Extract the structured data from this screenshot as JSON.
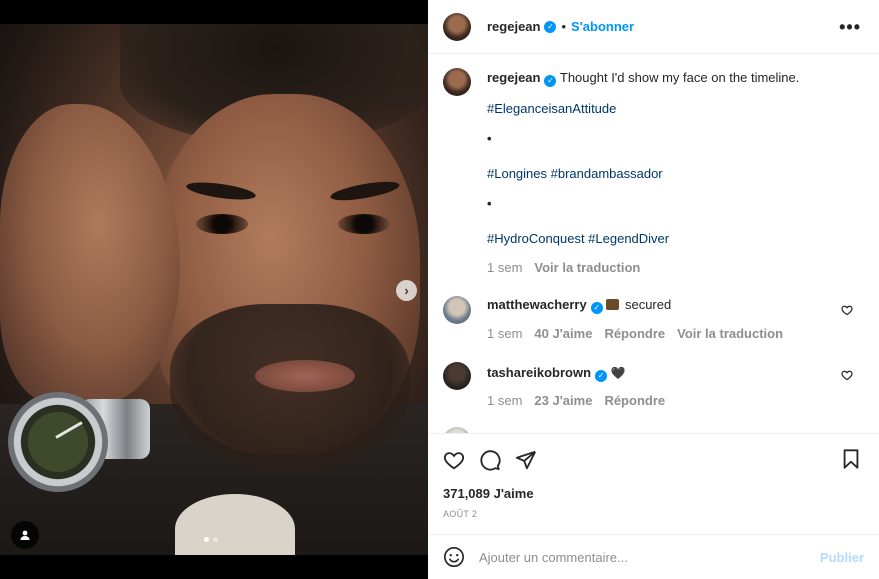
{
  "post": {
    "username": "regejean",
    "follow_label": "S'abonner",
    "separator": "•",
    "more_label": "•••",
    "caption": {
      "username": "regejean",
      "text": "Thought I'd show my face on the timeline.",
      "line1": "#EleganceisanAttitude",
      "dot1": "•",
      "line2": "#Longines #brandambassador",
      "dot2": "•",
      "line3": "#HydroConquest #LegendDiver",
      "time": "1 sem",
      "translate": "Voir la traduction"
    },
    "comments": [
      {
        "username": "matthewacherry",
        "text": "secured",
        "time": "1 sem",
        "likes": "40 J'aime",
        "reply": "Répondre",
        "translate": "Voir la traduction"
      },
      {
        "username": "tashareikobrown",
        "text": "🖤",
        "time": "1 sem",
        "likes": "23 J'aime",
        "reply": "Répondre"
      }
    ],
    "likes_count": "371,089 J'aime",
    "date": "AOÛT 2",
    "comment_placeholder": "Ajouter un commentaire...",
    "publish_label": "Publier",
    "carousel_next": "›"
  },
  "icons": {
    "verified": "verified-badge-icon",
    "like": "heart-icon",
    "comment": "comment-icon",
    "share": "send-icon",
    "save": "bookmark-icon",
    "emoji": "emoji-icon",
    "user_tag": "user-tag-icon"
  },
  "colors": {
    "link_blue": "#0095f6",
    "hashtag": "#00376b",
    "muted": "#8e8e8e",
    "publish_disabled": "#b3dbff"
  }
}
